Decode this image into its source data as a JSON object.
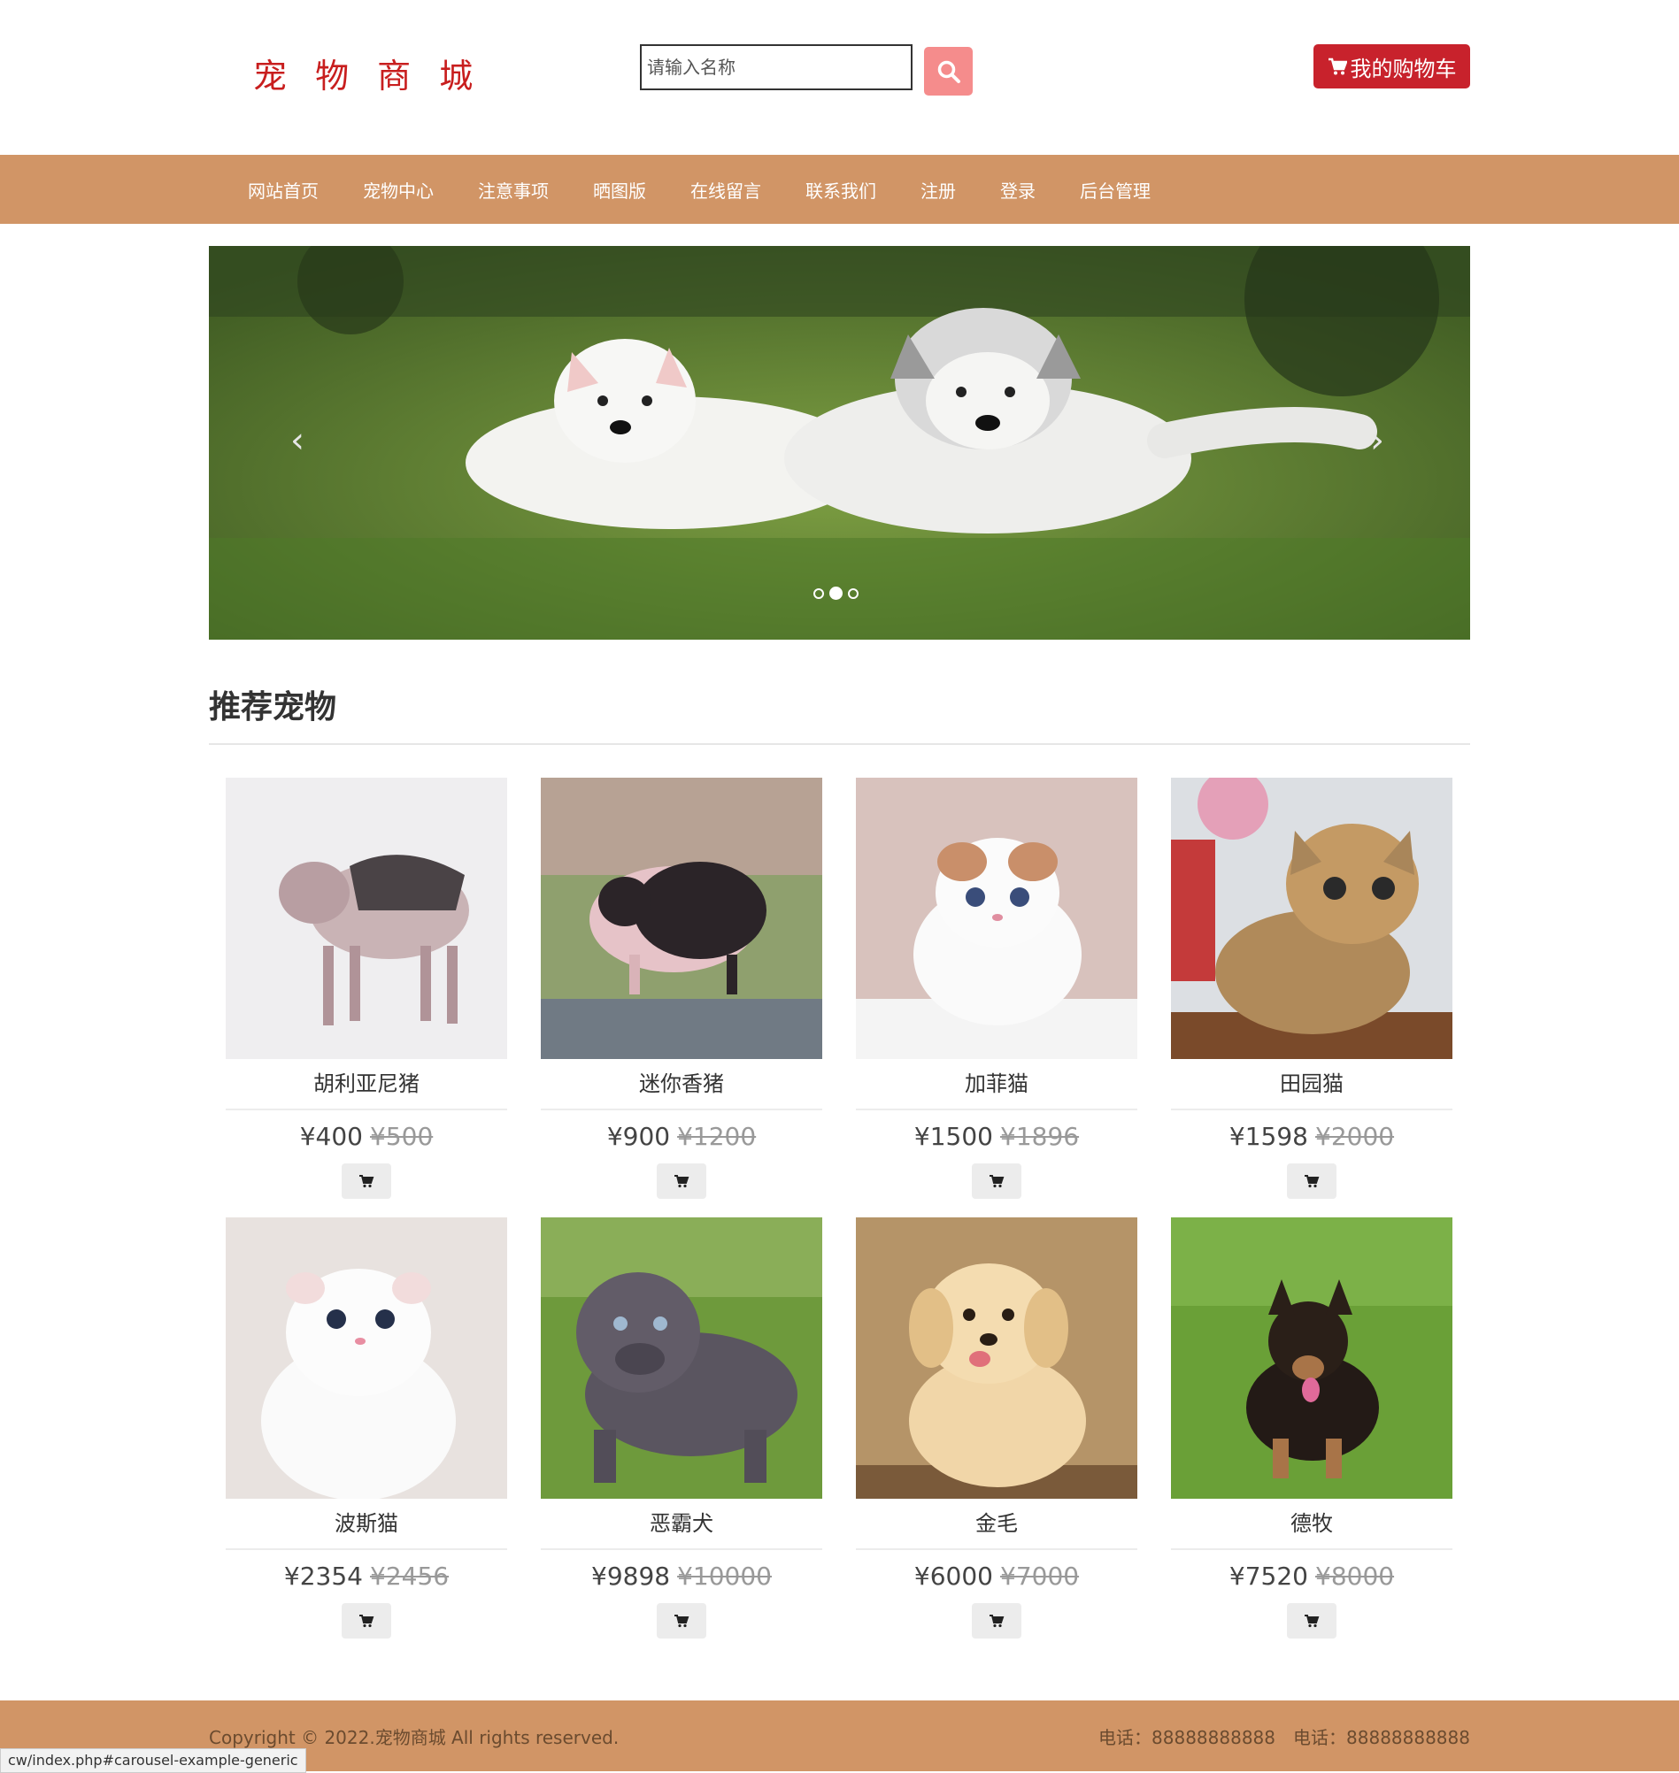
{
  "header": {
    "logo": "宠 物 商 城",
    "search_placeholder": "请输入名称",
    "cart_label": "我的购物车"
  },
  "nav": [
    "网站首页",
    "宠物中心",
    "注意事项",
    "晒图版",
    "在线留言",
    "联系我们",
    "注册",
    "登录",
    "后台管理"
  ],
  "section": {
    "title": "推荐宠物"
  },
  "products": [
    {
      "name": "胡利亚尼猪",
      "price": "¥400",
      "old_price": "¥500"
    },
    {
      "name": "迷你香猪",
      "price": "¥900",
      "old_price": "¥1200"
    },
    {
      "name": "加菲猫",
      "price": "¥1500",
      "old_price": "¥1896"
    },
    {
      "name": "田园猫",
      "price": "¥1598",
      "old_price": "¥2000"
    },
    {
      "name": "波斯猫",
      "price": "¥2354",
      "old_price": "¥2456"
    },
    {
      "name": "恶霸犬",
      "price": "¥9898",
      "old_price": "¥10000"
    },
    {
      "name": "金毛",
      "price": "¥6000",
      "old_price": "¥7000"
    },
    {
      "name": "德牧",
      "price": "¥7520",
      "old_price": "¥8000"
    }
  ],
  "footer": {
    "copyright": "Copyright © 2022.宠物商城 All rights reserved.",
    "phone1": "电话：88888888888",
    "phone2": "电话：88888888888"
  },
  "status_url": "cw/index.php#carousel-example-generic",
  "colors": {
    "nav_bg": "#d19566",
    "cart_btn": "#c8222c",
    "search_btn": "#f58c8c",
    "logo": "#c81e1e"
  }
}
